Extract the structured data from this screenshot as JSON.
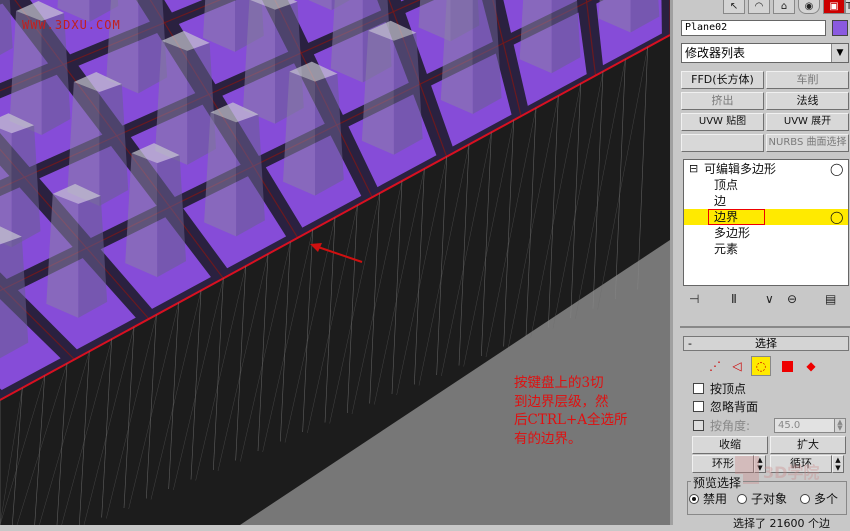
{
  "viewport": {
    "watermark": "WWW.3DXU.COM",
    "annotation": "按键盘上的3切\n到边界层级，然\n后CTRL+A全选所\n有的边界。",
    "colors": {
      "ground": "#777777",
      "purple": "#8b4fe0",
      "annotation": "#e01010",
      "watermark": "#c02020"
    }
  },
  "panel": {
    "toolbar_icons": [
      "cursor-icon",
      "arc-icon",
      "hierarchy-icon",
      "motion-icon",
      "display-icon",
      "utilities-icon"
    ],
    "object_name": "Plane02",
    "object_color": "#8a5ae0",
    "modifier_list": "修改器列表",
    "modifier_buttons": [
      {
        "label": "FFD(长方体)",
        "enabled": true
      },
      {
        "label": "车削",
        "enabled": false
      },
      {
        "label": "挤出",
        "enabled": false
      },
      {
        "label": "法线",
        "enabled": true
      },
      {
        "label": "UVW 贴图",
        "enabled": true
      },
      {
        "label": "UVW 展开",
        "enabled": true
      },
      {
        "label": "",
        "enabled": false
      },
      {
        "label": "NURBS 曲面选择",
        "enabled": false
      }
    ],
    "stack": {
      "root": "可编辑多边形",
      "items": [
        "顶点",
        "边",
        "边界",
        "多边形",
        "元素"
      ],
      "selected": "边界"
    },
    "stack_tools": [
      "pin-stack-icon",
      "show-end-result-icon",
      "make-unique-icon",
      "remove-modifier-icon",
      "configure-sets-icon"
    ],
    "selection": {
      "title": "选择",
      "collapse": "-",
      "modes": [
        "vertex-mode-icon",
        "edge-mode-icon",
        "border-mode-icon",
        "polygon-mode-icon",
        "element-mode-icon"
      ],
      "by_vertex": "按顶点",
      "ignore_backfacing": "忽略背面",
      "by_angle": "按角度:",
      "angle_value": "45.0",
      "shrink": "收缩",
      "grow": "扩大",
      "ring": "环形",
      "loop": "循环",
      "preview_label": "预览选择",
      "preview_options": [
        "禁用",
        "子对象",
        "多个"
      ],
      "preview_selected": "禁用",
      "status": "选择了 21600 个边",
      "logo_text": "3D学院"
    }
  }
}
